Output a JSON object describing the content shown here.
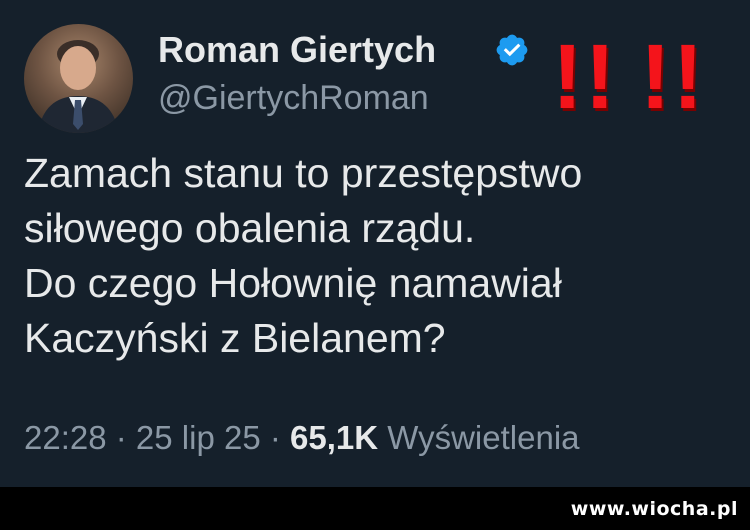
{
  "author": {
    "display_name": "Roman Giertych",
    "handle": "@GiertychRoman",
    "verified_icon": "verified-badge-icon",
    "verified_color": "#1d9bf0"
  },
  "annotation": {
    "marks_1": "!!",
    "marks_2": "!!",
    "color": "#f4141b"
  },
  "tweet": {
    "lines": [
      "Zamach stanu to przestępstwo",
      "siłowego obalenia rządu.",
      "Do czego Hołownię namawiał",
      "Kaczyński z Bielanem?"
    ]
  },
  "meta": {
    "time": "22:28",
    "separator_1": " · ",
    "date": "25 lip 25",
    "separator_2": " · ",
    "views_count": "65,1K",
    "views_label": " Wyświetlenia"
  },
  "watermark": {
    "text": "www.wiocha.pl"
  },
  "colors": {
    "background": "#15202b",
    "text_primary": "#e7e9ea",
    "text_secondary": "#8b98a5"
  }
}
